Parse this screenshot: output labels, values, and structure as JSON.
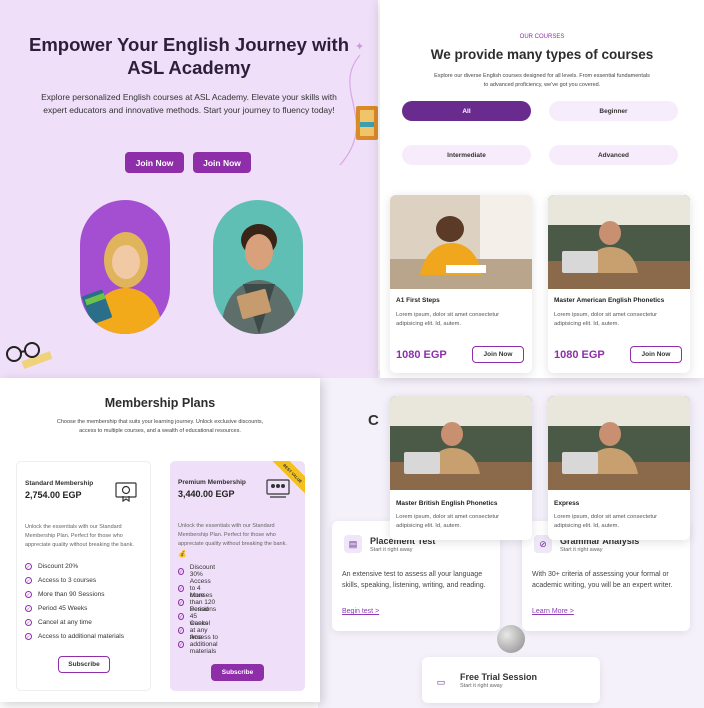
{
  "hero": {
    "title": "Empower Your English Journey with ASL Academy",
    "description": "Explore personalized English courses at ASL Academy. Elevate your skills with expert educators and innovative methods. Start your journey to fluency today!",
    "buttons": [
      "Join Now",
      "Join Now"
    ]
  },
  "courses": {
    "eyebrow": "OUR COURSES",
    "title": "We provide many types of courses",
    "description": "Explore our diverse English courses designed for all levels. From essential fundamentals to advanced proficiency, we've got you covered.",
    "filters": [
      "All",
      "Beginner",
      "Intermediate",
      "Advanced"
    ],
    "active_filter": "All",
    "cards": [
      {
        "title": "A1 First Steps",
        "text": "Lorem ipsum, dolor sit amet consectetur adipisicing elit. Id, autem.",
        "price": "1080 EGP",
        "button": "Join Now"
      },
      {
        "title": "Master American English Phonetics",
        "text": "Lorem ipsum, dolor sit amet consectetur adipisicing elit. Id, autem.",
        "price": "1080 EGP",
        "button": "Join Now"
      },
      {
        "title": "Master British English Phonetics",
        "text": "Lorem ipsum, dolor sit amet consectetur adipisicing elit. Id, autem."
      },
      {
        "title": "Express",
        "text": "Lorem ipsum, dolor sit amet consectetur adipisicing elit. Id, autem."
      }
    ]
  },
  "membership": {
    "title": "Membership Plans",
    "description": "Choose the membership that suits your learning journey. Unlock exclusive discounts, access to multiple courses, and a wealth of educational resources.",
    "standard": {
      "name": "Standard Membership",
      "price": "2,754.00 EGP",
      "description": "Unlock the essentials with our Standard Membership Plan. Perfect for those who appreciate quality without breaking the bank.",
      "features": [
        "Discount 20%",
        "Access to 3 courses",
        "More than 90 Sessions",
        "Period 45 Weeks",
        "Cancel at any time",
        "Access to additional materials"
      ],
      "button": "Subscribe"
    },
    "premium": {
      "name": "Premium Membership",
      "price": "3,440.00 EGP",
      "badge": "BEST VALUE",
      "description": "Unlock the essentials with our Standard Membership Plan. Perfect for those who appreciate quality without breaking the bank.",
      "features": [
        "Discount 30%",
        "Access to 4 courses",
        "More than 120 Sessions",
        "Period 45 weeks",
        "Cancel at any time",
        "Access to additional materials"
      ],
      "button": "Subscribe"
    }
  },
  "services": {
    "partial_heading": "C",
    "items": [
      {
        "title": "Placement Test",
        "sub": "Start it right away",
        "text": "An extensive test to assess all your language skills, speaking, listening, writing, and reading.",
        "link": "Begin test >"
      },
      {
        "title": "Grammar Analysis",
        "sub": "Start it right away",
        "text": "With 30+ criteria of assessing your formal or academic writing, you will be an expert writer.",
        "link": "Learn More >"
      },
      {
        "title": "Free Trial Session",
        "sub": "Start it right away"
      }
    ]
  },
  "colors": {
    "brand": "#8e2fa9",
    "brand_dark": "#6a2b8f",
    "hero_bg": "#efdff8",
    "badge": "#f4c01e"
  }
}
